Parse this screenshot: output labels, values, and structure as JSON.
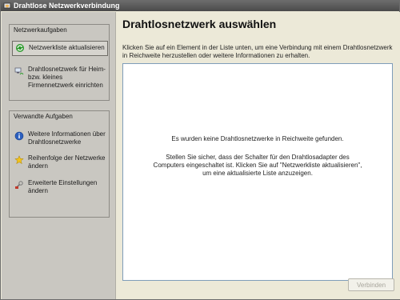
{
  "window": {
    "title": "Drahtlose Netzwerkverbindung",
    "icon": "wireless-network-icon"
  },
  "sidebar": {
    "network_tasks": {
      "title": "Netzwerkaufgaben",
      "items": [
        {
          "label": "Netzwerkliste aktualisieren",
          "icon": "refresh-icon",
          "selected": true
        },
        {
          "label": "Drahtlosnetzwerk für Heim- bzw. kleines Firmennetzwerk einrichten",
          "icon": "network-setup-icon",
          "selected": false
        }
      ]
    },
    "related_tasks": {
      "title": "Verwandte Aufgaben",
      "items": [
        {
          "label": "Weitere Informationen über Drahtlosnetzwerke",
          "icon": "info-icon"
        },
        {
          "label": "Reihenfolge der Netzwerke ändern",
          "icon": "star-icon"
        },
        {
          "label": "Erweiterte Einstellungen ändern",
          "icon": "advanced-settings-icon"
        }
      ]
    }
  },
  "main": {
    "heading": "Drahtlosnetzwerk auswählen",
    "description": "Klicken Sie auf ein Element in der Liste unten, um eine Verbindung mit einem Drahtlosnetzwerk in Reichweite herzustellen oder weitere Informationen zu erhalten.",
    "network_list": {
      "empty_message": "Es wurden keine Drahtlosnetzwerke in Reichweite gefunden.",
      "hint": "Stellen Sie sicher, dass der Schalter für den Drahtlosadapter des Computers eingeschaltet ist. Klicken Sie auf \"Netzwerkliste aktualisieren\", um eine aktualisierte Liste anzuzeigen."
    },
    "connect_button": "Verbinden"
  },
  "colors": {
    "titlebar": "#5a5a5a",
    "sidebar": "#c9c7c1",
    "window_bg": "#ece9d8",
    "disabled_text": "#a7a59c"
  }
}
